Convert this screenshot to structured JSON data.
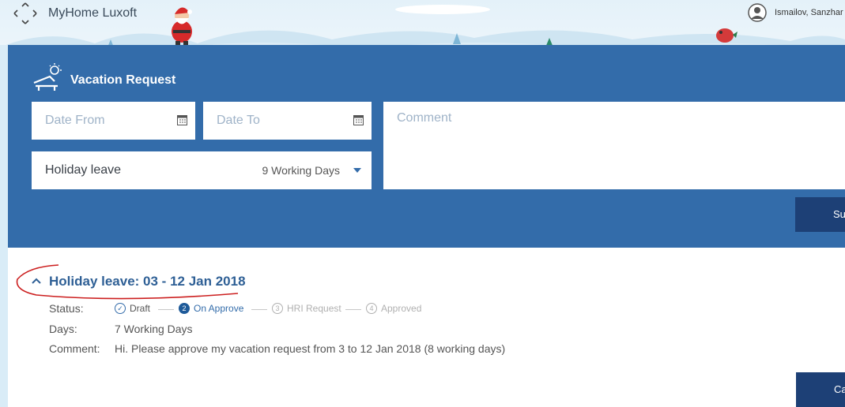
{
  "header": {
    "app_title": "MyHome Luxoft",
    "user_name": "Ismailov, Sanzhar"
  },
  "vacation_form": {
    "title": "Vacation Request",
    "date_from_placeholder": "Date From",
    "date_to_placeholder": "Date To",
    "leave_type": "Holiday leave",
    "working_days": "9 Working Days",
    "comment_placeholder": "Comment",
    "submit_label": "Submit"
  },
  "request": {
    "title": "Holiday leave: 03 - 12 Jan 2018",
    "status_label": "Status:",
    "days_label": "Days:",
    "days_value": "7 Working Days",
    "comment_label": "Comment:",
    "comment_value": "Hi. Please approve my vacation request from 3 to 12 Jan 2018 (8 working days)",
    "steps": [
      {
        "number": "✓",
        "label": "Draft",
        "state": "done"
      },
      {
        "number": "2",
        "label": "On Approve",
        "state": "active"
      },
      {
        "number": "3",
        "label": "HRI Request",
        "state": "pending"
      },
      {
        "number": "4",
        "label": "Approved",
        "state": "pending"
      }
    ],
    "cancel_label": "Cancel"
  },
  "icons": [
    "app-switcher-icon",
    "user-avatar-icon",
    "beach-chair-icon",
    "calendar-icon",
    "chevron-down-icon",
    "chevron-up-icon"
  ],
  "colors": {
    "panel": "#336caa",
    "button": "#1d4076",
    "link": "#2e5f95"
  }
}
